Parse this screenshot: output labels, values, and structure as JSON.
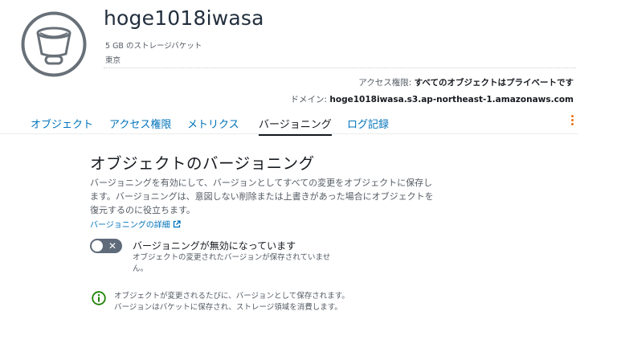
{
  "bucket": {
    "name": "hoge1018iwasa",
    "subtitle": "5 GB のストレージバケット",
    "region": "東京",
    "access_label": "アクセス権限:",
    "access_value": "すべてのオブジェクトはプライベートです",
    "domain_label": "ドメイン:",
    "domain_value": "hoge1018iwasa.s3.ap-northeast-1.amazonaws.com"
  },
  "tabs": [
    {
      "label": "オブジェクト"
    },
    {
      "label": "アクセス権限"
    },
    {
      "label": "メトリクス"
    },
    {
      "label": "バージョニング"
    },
    {
      "label": "ログ記録"
    }
  ],
  "active_tab": 3,
  "versioning": {
    "title": "オブジェクトのバージョニング",
    "description": "バージョニングを有効にして、バージョンとしてすべての変更をオブジェクトに保存します。バージョニングは、意図しない削除または上書きがあった場合にオブジェクトを復元するのに役立ちます。",
    "detail_link": "バージョニングの詳細",
    "toggle_state": "off",
    "toggle_title": "バージョニングが無効になっています",
    "toggle_desc": "オブジェクトの変更されたバージョンが保存されていません。",
    "info_line1": "オブジェクトが変更されるたびに、バージョンとして保存されます。",
    "info_line2": "バージョンはバケットに保存され、ストレージ領域を消費します。"
  },
  "icons": {
    "bucket": "bucket-icon",
    "menu": "kebab-icon",
    "external": "external-link-icon",
    "info": "info-icon",
    "toggle_off": "close-icon"
  },
  "colors": {
    "link": "#0073bb",
    "accent": "#ec7211",
    "info": "#1d8102",
    "toggle_off": "#5f6b7a",
    "icon_gray": "#687078"
  }
}
